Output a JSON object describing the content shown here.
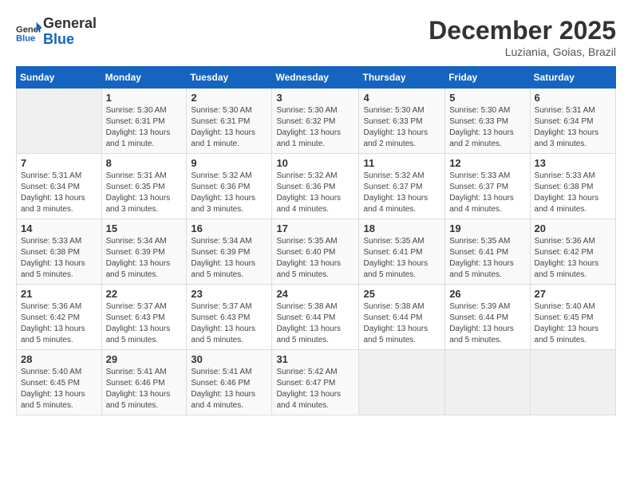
{
  "header": {
    "logo_line1": "General",
    "logo_line2": "Blue",
    "month": "December 2025",
    "location": "Luziania, Goias, Brazil"
  },
  "days_of_week": [
    "Sunday",
    "Monday",
    "Tuesday",
    "Wednesday",
    "Thursday",
    "Friday",
    "Saturday"
  ],
  "weeks": [
    [
      {
        "day": "",
        "info": ""
      },
      {
        "day": "1",
        "info": "Sunrise: 5:30 AM\nSunset: 6:31 PM\nDaylight: 13 hours\nand 1 minute."
      },
      {
        "day": "2",
        "info": "Sunrise: 5:30 AM\nSunset: 6:31 PM\nDaylight: 13 hours\nand 1 minute."
      },
      {
        "day": "3",
        "info": "Sunrise: 5:30 AM\nSunset: 6:32 PM\nDaylight: 13 hours\nand 1 minute."
      },
      {
        "day": "4",
        "info": "Sunrise: 5:30 AM\nSunset: 6:33 PM\nDaylight: 13 hours\nand 2 minutes."
      },
      {
        "day": "5",
        "info": "Sunrise: 5:30 AM\nSunset: 6:33 PM\nDaylight: 13 hours\nand 2 minutes."
      },
      {
        "day": "6",
        "info": "Sunrise: 5:31 AM\nSunset: 6:34 PM\nDaylight: 13 hours\nand 3 minutes."
      }
    ],
    [
      {
        "day": "7",
        "info": "Sunrise: 5:31 AM\nSunset: 6:34 PM\nDaylight: 13 hours\nand 3 minutes."
      },
      {
        "day": "8",
        "info": "Sunrise: 5:31 AM\nSunset: 6:35 PM\nDaylight: 13 hours\nand 3 minutes."
      },
      {
        "day": "9",
        "info": "Sunrise: 5:32 AM\nSunset: 6:36 PM\nDaylight: 13 hours\nand 3 minutes."
      },
      {
        "day": "10",
        "info": "Sunrise: 5:32 AM\nSunset: 6:36 PM\nDaylight: 13 hours\nand 4 minutes."
      },
      {
        "day": "11",
        "info": "Sunrise: 5:32 AM\nSunset: 6:37 PM\nDaylight: 13 hours\nand 4 minutes."
      },
      {
        "day": "12",
        "info": "Sunrise: 5:33 AM\nSunset: 6:37 PM\nDaylight: 13 hours\nand 4 minutes."
      },
      {
        "day": "13",
        "info": "Sunrise: 5:33 AM\nSunset: 6:38 PM\nDaylight: 13 hours\nand 4 minutes."
      }
    ],
    [
      {
        "day": "14",
        "info": "Sunrise: 5:33 AM\nSunset: 6:38 PM\nDaylight: 13 hours\nand 5 minutes."
      },
      {
        "day": "15",
        "info": "Sunrise: 5:34 AM\nSunset: 6:39 PM\nDaylight: 13 hours\nand 5 minutes."
      },
      {
        "day": "16",
        "info": "Sunrise: 5:34 AM\nSunset: 6:39 PM\nDaylight: 13 hours\nand 5 minutes."
      },
      {
        "day": "17",
        "info": "Sunrise: 5:35 AM\nSunset: 6:40 PM\nDaylight: 13 hours\nand 5 minutes."
      },
      {
        "day": "18",
        "info": "Sunrise: 5:35 AM\nSunset: 6:41 PM\nDaylight: 13 hours\nand 5 minutes."
      },
      {
        "day": "19",
        "info": "Sunrise: 5:35 AM\nSunset: 6:41 PM\nDaylight: 13 hours\nand 5 minutes."
      },
      {
        "day": "20",
        "info": "Sunrise: 5:36 AM\nSunset: 6:42 PM\nDaylight: 13 hours\nand 5 minutes."
      }
    ],
    [
      {
        "day": "21",
        "info": "Sunrise: 5:36 AM\nSunset: 6:42 PM\nDaylight: 13 hours\nand 5 minutes."
      },
      {
        "day": "22",
        "info": "Sunrise: 5:37 AM\nSunset: 6:43 PM\nDaylight: 13 hours\nand 5 minutes."
      },
      {
        "day": "23",
        "info": "Sunrise: 5:37 AM\nSunset: 6:43 PM\nDaylight: 13 hours\nand 5 minutes."
      },
      {
        "day": "24",
        "info": "Sunrise: 5:38 AM\nSunset: 6:44 PM\nDaylight: 13 hours\nand 5 minutes."
      },
      {
        "day": "25",
        "info": "Sunrise: 5:38 AM\nSunset: 6:44 PM\nDaylight: 13 hours\nand 5 minutes."
      },
      {
        "day": "26",
        "info": "Sunrise: 5:39 AM\nSunset: 6:44 PM\nDaylight: 13 hours\nand 5 minutes."
      },
      {
        "day": "27",
        "info": "Sunrise: 5:40 AM\nSunset: 6:45 PM\nDaylight: 13 hours\nand 5 minutes."
      }
    ],
    [
      {
        "day": "28",
        "info": "Sunrise: 5:40 AM\nSunset: 6:45 PM\nDaylight: 13 hours\nand 5 minutes."
      },
      {
        "day": "29",
        "info": "Sunrise: 5:41 AM\nSunset: 6:46 PM\nDaylight: 13 hours\nand 5 minutes."
      },
      {
        "day": "30",
        "info": "Sunrise: 5:41 AM\nSunset: 6:46 PM\nDaylight: 13 hours\nand 4 minutes."
      },
      {
        "day": "31",
        "info": "Sunrise: 5:42 AM\nSunset: 6:47 PM\nDaylight: 13 hours\nand 4 minutes."
      },
      {
        "day": "",
        "info": ""
      },
      {
        "day": "",
        "info": ""
      },
      {
        "day": "",
        "info": ""
      }
    ]
  ]
}
